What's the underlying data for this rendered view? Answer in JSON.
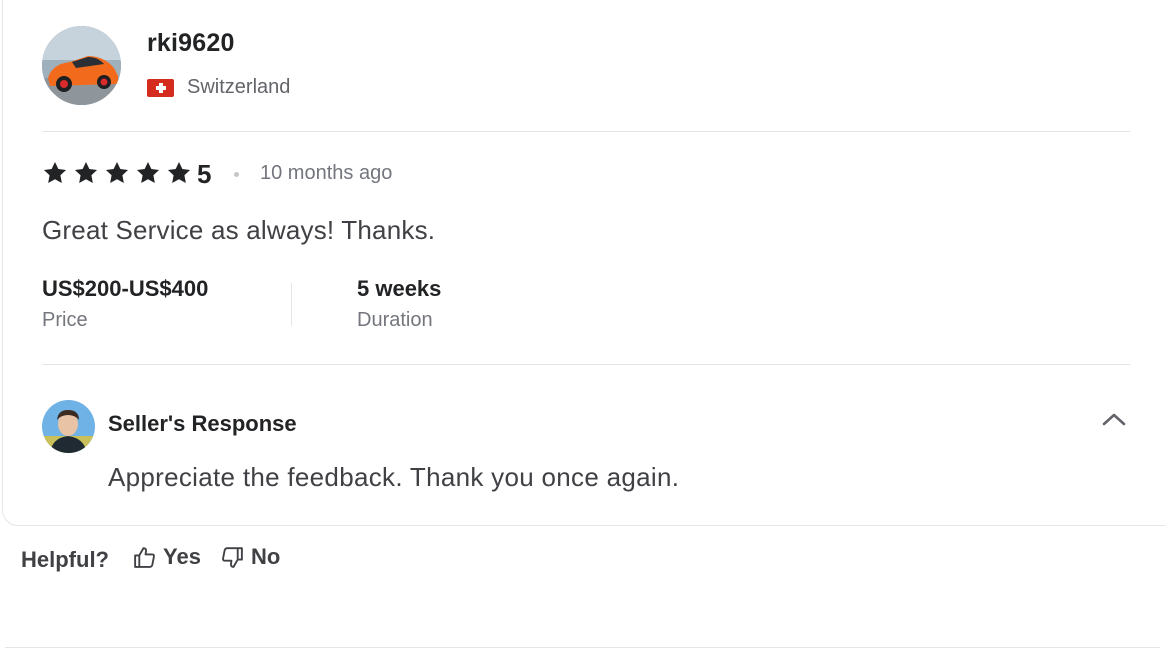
{
  "reviewer": {
    "username": "rki9620",
    "country": "Switzerland",
    "flag_icon": "switzerland-flag-icon"
  },
  "review": {
    "rating": 5,
    "rating_label": "5",
    "stars_max": 5,
    "time_ago": "10 months ago",
    "text": "Great Service as always! Thanks.",
    "price_value": "US$200-US$400",
    "price_label": "Price",
    "duration_value": "5 weeks",
    "duration_label": "Duration"
  },
  "seller_response": {
    "title": "Seller's Response",
    "text": "Appreciate the feedback. Thank you once again.",
    "toggle_icon": "chevron-up-icon"
  },
  "helpful": {
    "label": "Helpful?",
    "yes_label": "Yes",
    "no_label": "No",
    "yes_icon": "thumbs-up-icon",
    "no_icon": "thumbs-down-icon"
  },
  "colors": {
    "star": "#222325",
    "text_primary": "#222325",
    "text_secondary": "#74767e",
    "divider": "#e4e5e7",
    "flag_red": "#d52b1e"
  }
}
